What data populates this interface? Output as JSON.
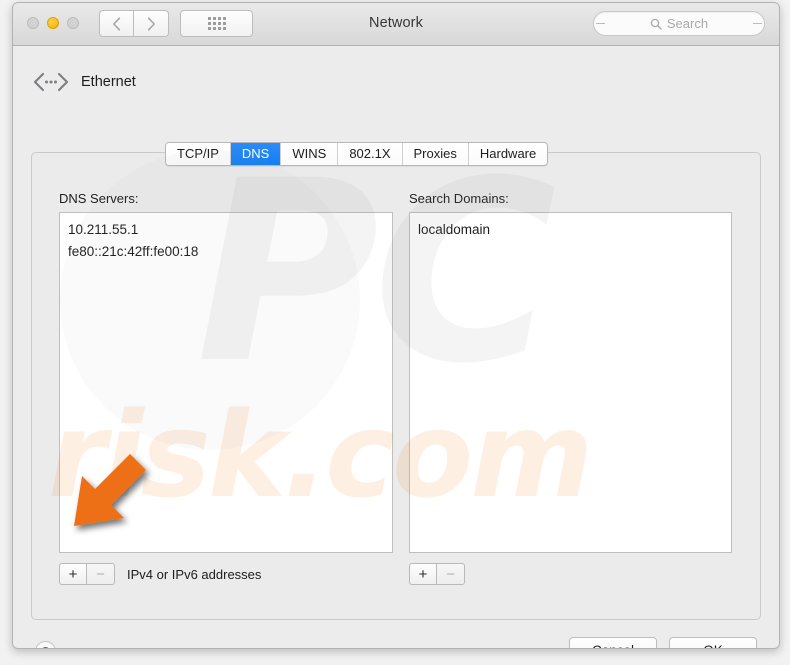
{
  "window": {
    "title": "Network",
    "traffic_lights": [
      "close",
      "minimize",
      "zoom"
    ]
  },
  "toolbar": {
    "back_icon": "chevron-left-icon",
    "forward_icon": "chevron-right-icon",
    "show_all_icon": "grid-dots-icon",
    "search": {
      "placeholder": "Search",
      "icon": "search-icon",
      "value": ""
    }
  },
  "interface": {
    "icon": "ethernet-icon",
    "name": "Ethernet"
  },
  "tabs": [
    {
      "label": "TCP/IP",
      "active": false
    },
    {
      "label": "DNS",
      "active": true
    },
    {
      "label": "WINS",
      "active": false
    },
    {
      "label": "802.1X",
      "active": false
    },
    {
      "label": "Proxies",
      "active": false
    },
    {
      "label": "Hardware",
      "active": false
    }
  ],
  "dns_servers": {
    "label": "DNS Servers:",
    "entries": [
      "10.211.55.1",
      "fe80::21c:42ff:fe00:18"
    ],
    "add_label": "+",
    "remove_label": "−",
    "hint": "IPv4 or IPv6 addresses"
  },
  "search_domains": {
    "label": "Search Domains:",
    "entries": [
      "localdomain"
    ],
    "add_label": "+",
    "remove_label": "−",
    "hint": ""
  },
  "footer": {
    "help_label": "?",
    "cancel_label": "Cancel",
    "ok_label": "OK"
  },
  "annotation": {
    "arrow_color": "#ED7014",
    "arrow_direction": "down-left",
    "points_at": "dns-servers-add-button"
  },
  "watermark": {
    "primary": "PC",
    "secondary": "risk.com",
    "primary_color": "#969696",
    "secondary_color": "#F3821E"
  },
  "colors": {
    "tab_active": "#1A7CF2",
    "help_glyph": "#1A7CED",
    "window_chrome": "#ECECEC"
  }
}
